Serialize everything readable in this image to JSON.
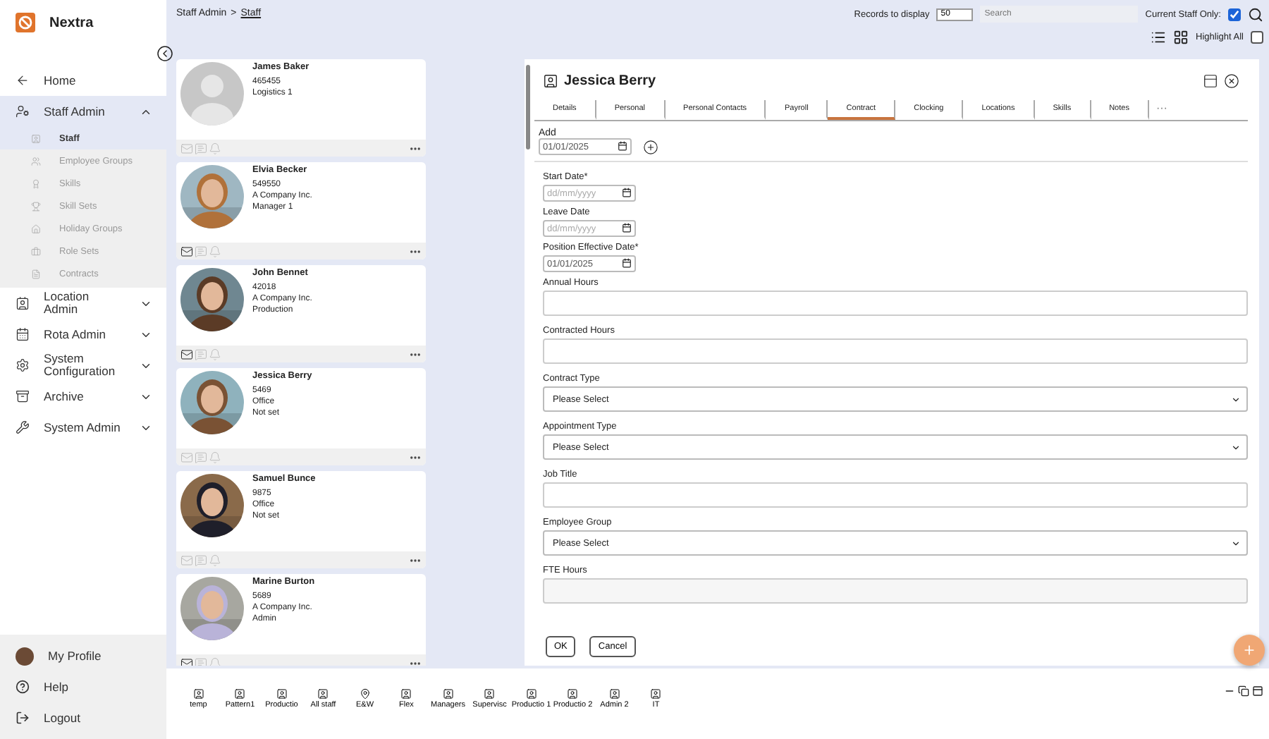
{
  "brand": {
    "name": "Nextra"
  },
  "sidebar": {
    "items": [
      {
        "label": "Home",
        "kind": "link"
      },
      {
        "label": "Staff Admin",
        "kind": "group",
        "expanded": true,
        "children": [
          {
            "label": "Staff",
            "selected": true
          },
          {
            "label": "Employee Groups",
            "selected": false
          },
          {
            "label": "Skills",
            "selected": false
          },
          {
            "label": "Skill Sets",
            "selected": false
          },
          {
            "label": "Holiday Groups",
            "selected": false
          },
          {
            "label": "Role Sets",
            "selected": false
          },
          {
            "label": "Contracts",
            "selected": false
          }
        ]
      },
      {
        "label": "Location Admin",
        "kind": "group",
        "expanded": false
      },
      {
        "label": "Rota Admin",
        "kind": "group",
        "expanded": false
      },
      {
        "label": "System Configuration",
        "kind": "group",
        "expanded": false
      },
      {
        "label": "Archive",
        "kind": "group",
        "expanded": false
      },
      {
        "label": "System Admin",
        "kind": "group",
        "expanded": false
      }
    ],
    "footer": [
      {
        "label": "My Profile",
        "kind": "avatar"
      },
      {
        "label": "Help",
        "kind": "help"
      },
      {
        "label": "Logout",
        "kind": "logout"
      }
    ]
  },
  "breadcrumb": [
    {
      "label": "Staff Admin",
      "link": false
    },
    {
      "label": ">",
      "link": false
    },
    {
      "label": "Staff",
      "link": true
    }
  ],
  "toolbar": {
    "records_label": "Records to display",
    "records_value": "50",
    "search_placeholder": "Search",
    "current_staff_label": "Current Staff Only:",
    "current_staff_checked": true,
    "highlight_label": "Highlight All",
    "highlight_checked": false
  },
  "staff": [
    {
      "name": "James Baker",
      "lines": [
        "465455",
        "Logistics 1"
      ],
      "kind": "placeholder",
      "mail_enabled": false
    },
    {
      "name": "Elvia Becker",
      "lines": [
        "549550",
        "A Company Inc.",
        "Manager 1"
      ],
      "mail_enabled": true
    },
    {
      "name": "John Bennet",
      "lines": [
        "42018",
        "A Company Inc.",
        "Production"
      ],
      "mail_enabled": true
    },
    {
      "name": "Jessica Berry",
      "lines": [
        "5469",
        "Office",
        "Not set"
      ],
      "mail_enabled": false
    },
    {
      "name": "Samuel Bunce",
      "lines": [
        "9875",
        "Office",
        "Not set"
      ],
      "mail_enabled": false
    },
    {
      "name": "Marine Burton",
      "lines": [
        "5689",
        "A Company Inc.",
        "Admin"
      ],
      "mail_enabled": true
    }
  ],
  "detail": {
    "title": "Jessica Berry",
    "tabs": [
      {
        "label": "Details",
        "selected": false
      },
      {
        "label": "Personal",
        "selected": false
      },
      {
        "label": "Personal Contacts",
        "selected": false
      },
      {
        "label": "Payroll",
        "selected": false
      },
      {
        "label": "Contract",
        "selected": true
      },
      {
        "label": "Clocking",
        "selected": false
      },
      {
        "label": "Locations",
        "selected": false
      },
      {
        "label": "Skills",
        "selected": false
      },
      {
        "label": "Notes",
        "selected": false
      }
    ],
    "more_tabs": "···",
    "add": {
      "label": "Add",
      "value": "01/01/2025"
    },
    "fields": [
      {
        "label": "Start Date*",
        "kind": "date",
        "placeholder": "dd/mm/yyyy"
      },
      {
        "label": "Leave Date",
        "kind": "date",
        "placeholder": "dd/mm/yyyy"
      },
      {
        "label": "Position Effective Date*",
        "kind": "date",
        "value": "01/01/2025"
      },
      {
        "label": "Annual Hours",
        "kind": "text"
      },
      {
        "label": "Contracted Hours",
        "kind": "text"
      },
      {
        "label": "Contract Type",
        "kind": "select",
        "value": "Please Select"
      },
      {
        "label": "Appointment Type",
        "kind": "select",
        "value": "Please Select"
      },
      {
        "label": "Job Title",
        "kind": "text"
      },
      {
        "label": "Employee Group",
        "kind": "select",
        "value": "Please Select"
      },
      {
        "label": "FTE Hours",
        "kind": "readonly"
      }
    ],
    "buttons": [
      "OK",
      "Cancel"
    ]
  },
  "groups": [
    {
      "label": "temp",
      "kind": "person"
    },
    {
      "label": "Pattern1",
      "kind": "person"
    },
    {
      "label": "Productio",
      "kind": "person"
    },
    {
      "label": "All staff",
      "kind": "person"
    },
    {
      "label": "E&W",
      "kind": "location"
    },
    {
      "label": "Flex",
      "kind": "person"
    },
    {
      "label": "Managers",
      "kind": "person"
    },
    {
      "label": "Supervisc",
      "kind": "person"
    },
    {
      "label": "Productio 1",
      "kind": "person"
    },
    {
      "label": "Productio 2",
      "kind": "person"
    },
    {
      "label": "Admin 2",
      "kind": "person"
    },
    {
      "label": "IT",
      "kind": "person"
    }
  ]
}
